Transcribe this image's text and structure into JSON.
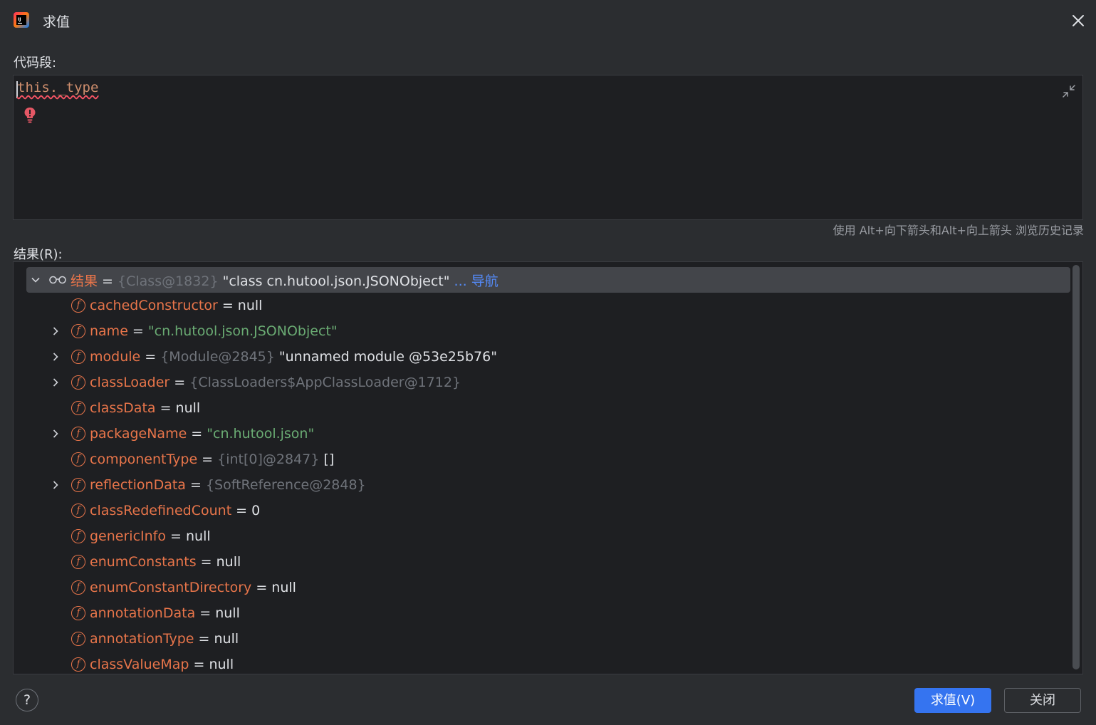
{
  "window": {
    "title": "求值",
    "app_icon": "intellij-idea-icon",
    "close_icon": "close-icon"
  },
  "code_fragment": {
    "label": "代码段:",
    "code": "this._type",
    "hint": "使用 Alt+向下箭头和Alt+向上箭头 浏览历史记录"
  },
  "result": {
    "label": "结果(R):",
    "root": {
      "name": "结果",
      "eq": " = ",
      "type": "{Class@1832}",
      "value": " \"class cn.hutool.json.JSONObject\"",
      "link": " ... 导航"
    },
    "fields": [
      {
        "name": "cachedConstructor",
        "type": "",
        "value": "null",
        "kind": "plain",
        "expandable": false
      },
      {
        "name": "name",
        "type": "",
        "value": "\"cn.hutool.json.JSONObject\"",
        "kind": "string",
        "expandable": true
      },
      {
        "name": "module",
        "type": "{Module@2845}",
        "value": "\"unnamed module @53e25b76\"",
        "kind": "plain",
        "expandable": true
      },
      {
        "name": "classLoader",
        "type": "{ClassLoaders$AppClassLoader@1712}",
        "value": "",
        "kind": "plain",
        "expandable": true
      },
      {
        "name": "classData",
        "type": "",
        "value": "null",
        "kind": "plain",
        "expandable": false
      },
      {
        "name": "packageName",
        "type": "",
        "value": "\"cn.hutool.json\"",
        "kind": "string",
        "expandable": true
      },
      {
        "name": "componentType",
        "type": "{int[0]@2847}",
        "value": "[]",
        "kind": "plain",
        "expandable": false
      },
      {
        "name": "reflectionData",
        "type": "{SoftReference@2848}",
        "value": "",
        "kind": "plain",
        "expandable": true
      },
      {
        "name": "classRedefinedCount",
        "type": "",
        "value": "0",
        "kind": "plain",
        "expandable": false
      },
      {
        "name": "genericInfo",
        "type": "",
        "value": "null",
        "kind": "plain",
        "expandable": false
      },
      {
        "name": "enumConstants",
        "type": "",
        "value": "null",
        "kind": "plain",
        "expandable": false
      },
      {
        "name": "enumConstantDirectory",
        "type": "",
        "value": "null",
        "kind": "plain",
        "expandable": false
      },
      {
        "name": "annotationData",
        "type": "",
        "value": "null",
        "kind": "plain",
        "expandable": false
      },
      {
        "name": "annotationType",
        "type": "",
        "value": "null",
        "kind": "plain",
        "expandable": false
      },
      {
        "name": "classValueMap",
        "type": "",
        "value": "null",
        "kind": "plain",
        "expandable": false
      }
    ],
    "field_icon_letter": "f",
    "eq": " = "
  },
  "footer": {
    "help": "?",
    "evaluate_button": "求值(V)",
    "close_button": "关闭"
  },
  "colors": {
    "background": "#2b2d30",
    "editor_background": "#1e1f22",
    "field_name": "#e8754a",
    "string_value": "#6aab73",
    "type_hint": "#6f737a",
    "link": "#548af7",
    "primary_button": "#3574f0"
  }
}
